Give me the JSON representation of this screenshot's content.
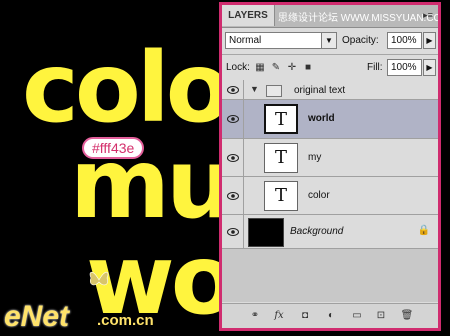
{
  "canvas": {
    "words": [
      "colo",
      "mu",
      "wo"
    ],
    "hex_label": "#fff43e",
    "logo_text": "eNet",
    "logo_sub": ".com.cn",
    "text_color": "#fff43e"
  },
  "panel": {
    "tab_label": "LAYERS",
    "watermark": "思缘设计论坛 WWW.MISSYUAN.COM",
    "blend_mode": "Normal",
    "opacity_label": "Opacity:",
    "opacity_value": "100%",
    "lock_label": "Lock:",
    "fill_label": "Fill:",
    "fill_value": "100%",
    "group_name": "original text",
    "layers": [
      {
        "name": "world",
        "thumb": "T",
        "selected": true
      },
      {
        "name": "my",
        "thumb": "T",
        "selected": false
      },
      {
        "name": "color",
        "thumb": "T",
        "selected": false
      }
    ],
    "background_name": "Background"
  }
}
